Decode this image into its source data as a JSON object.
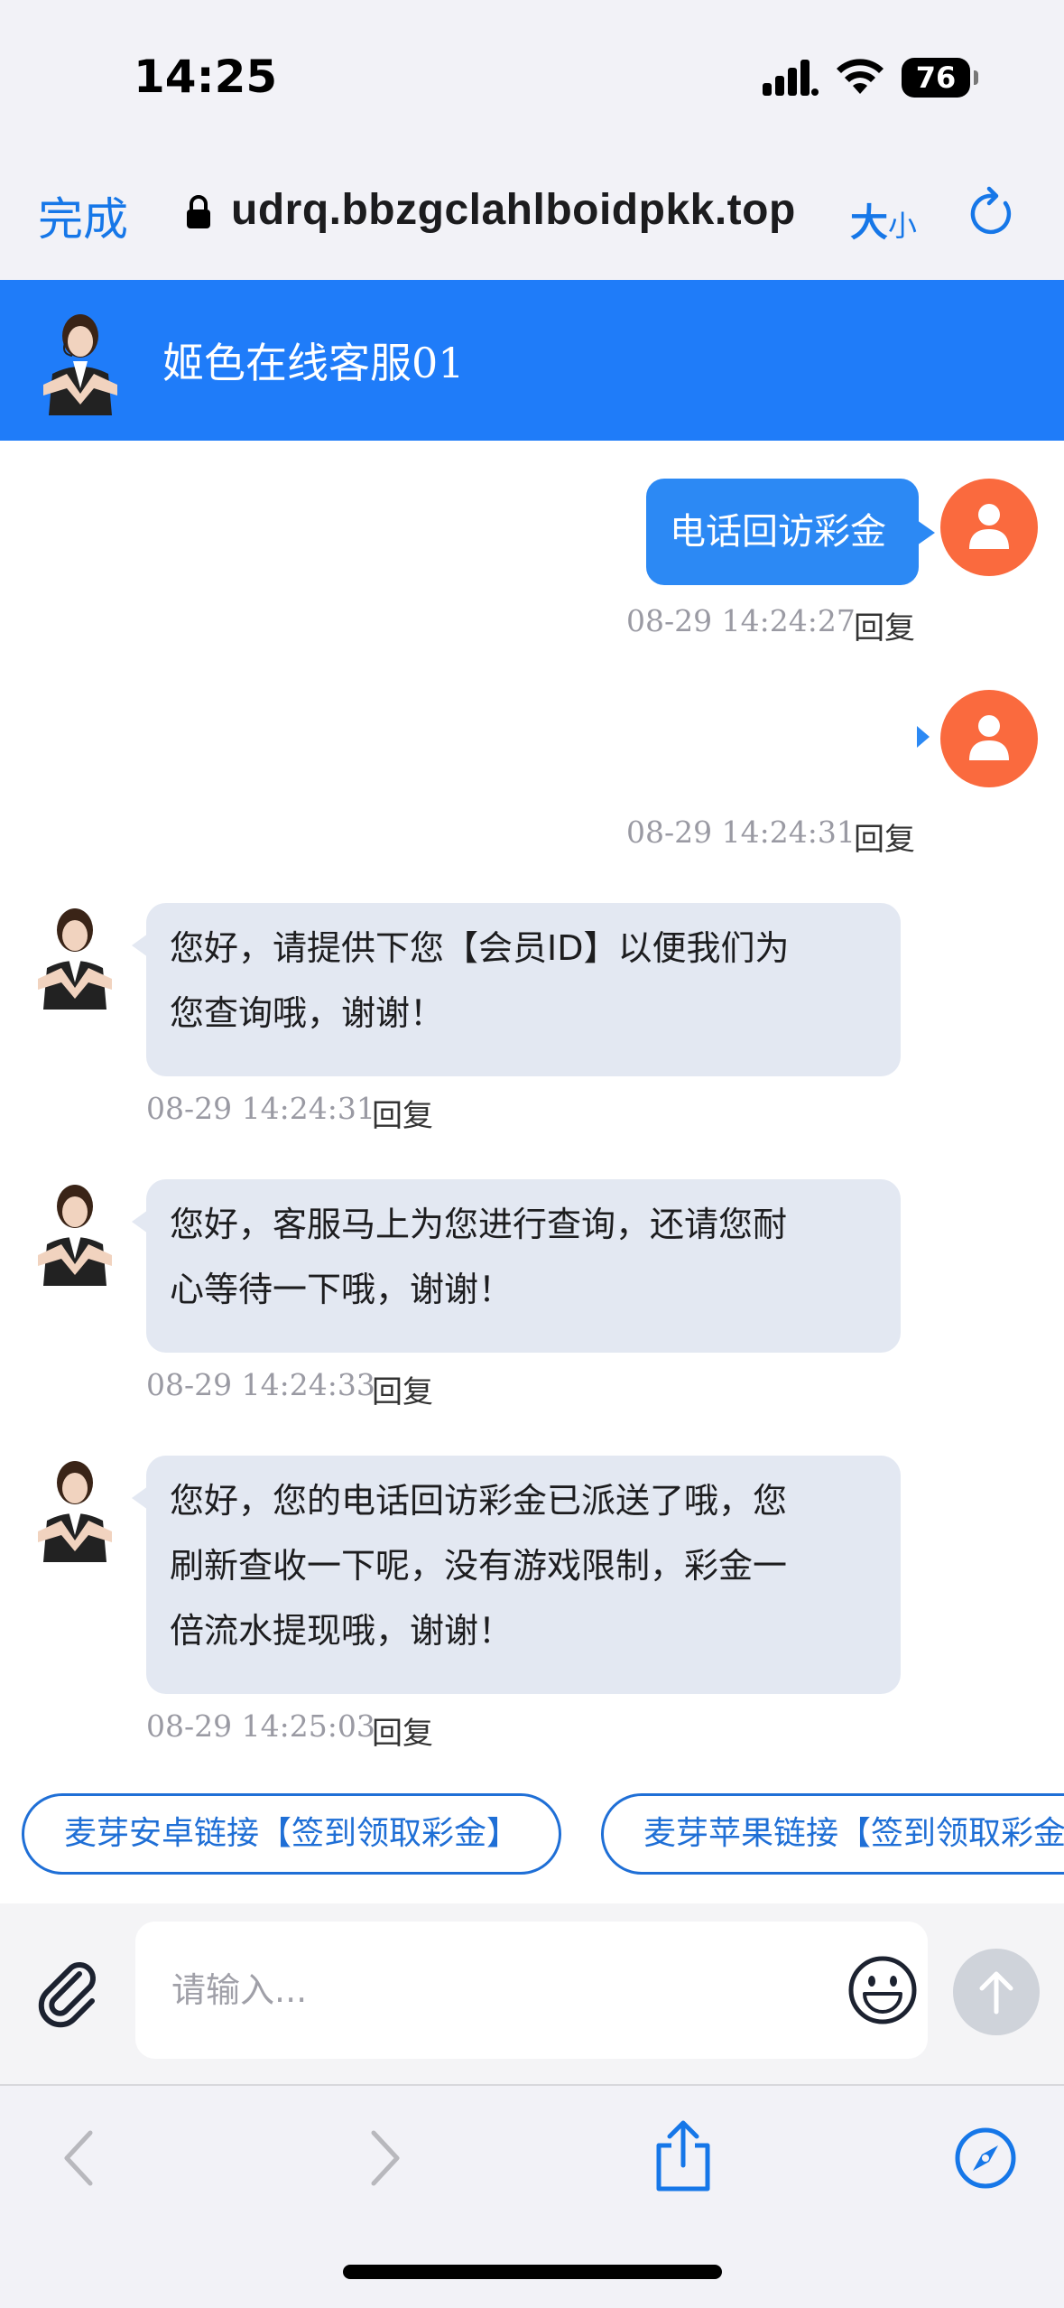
{
  "status_bar": {
    "time": "14:25",
    "battery": "76",
    "icons": [
      "cellular-signal-icon",
      "wifi-icon",
      "battery-icon"
    ]
  },
  "browser": {
    "done_label": "完成",
    "url": "udrq.bbzgclahlboidpkk.top",
    "text_size_label_big": "大",
    "text_size_label_small": "小",
    "icons": [
      "lock-icon",
      "reload-icon"
    ]
  },
  "chat_header": {
    "title": "姬色在线客服01"
  },
  "messages": [
    {
      "from": "user",
      "text": "电话回访彩金",
      "time": "08-29 14:24:27",
      "reply": "回复"
    },
    {
      "from": "user",
      "text": "",
      "time": "08-29 14:24:31",
      "reply": "回复"
    },
    {
      "from": "agent",
      "lines": [
        "您好，请提供下您【会员ID】以便我们为",
        "您查询哦，谢谢！"
      ],
      "time": "08-29 14:24:31",
      "reply": "回复"
    },
    {
      "from": "agent",
      "lines": [
        "您好，客服马上为您进行查询，还请您耐",
        "心等待一下哦，谢谢！"
      ],
      "time": "08-29 14:24:33",
      "reply": "回复"
    },
    {
      "from": "agent",
      "lines": [
        "您好，您的电话回访彩金已派送了哦，您",
        "刷新查收一下呢，没有游戏限制，彩金一",
        "倍流水提现哦，谢谢！"
      ],
      "time": "08-29 14:25:03",
      "reply": "回复"
    }
  ],
  "quick_links": [
    "麦芽安卓链接【签到领取彩金】",
    "麦芽苹果链接【签到领取彩金】"
  ],
  "input": {
    "placeholder": "请输入..."
  },
  "colors": {
    "header_blue": "#1f7cf9",
    "user_bubble": "#2c89f4",
    "agent_bubble": "#e3e8f2",
    "user_avatar": "#fa6a3e",
    "link_blue": "#1f6fd6"
  }
}
